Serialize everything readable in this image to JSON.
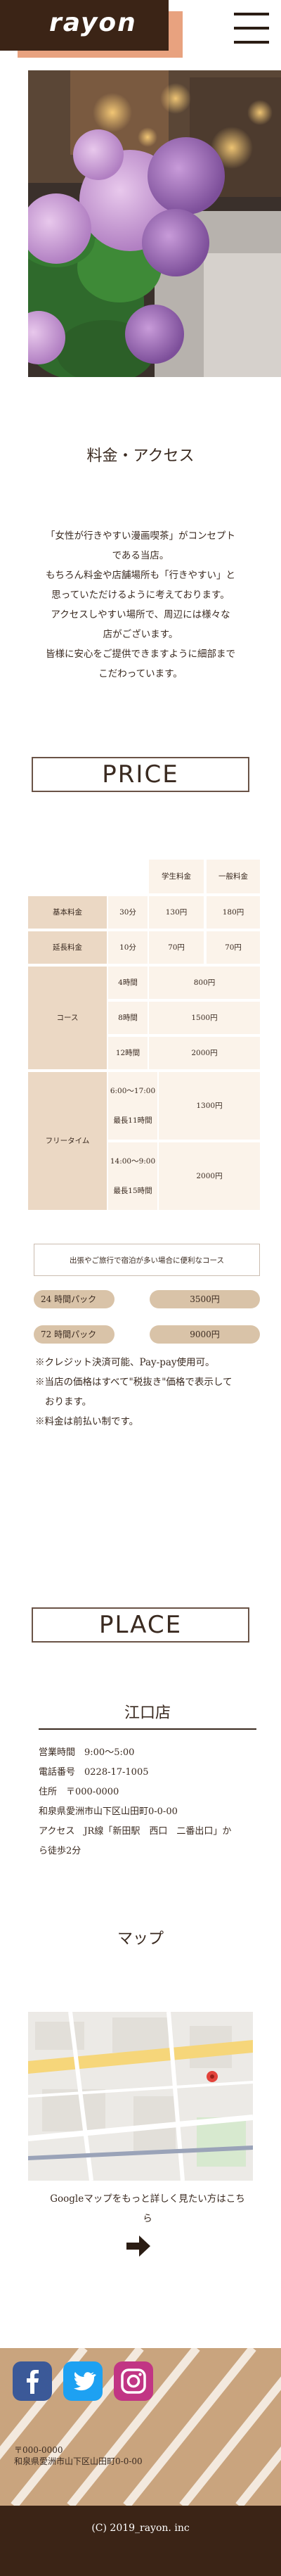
{
  "header": {
    "logo": "rayon",
    "menu_icon": "hamburger-menu-icon"
  },
  "hero": {
    "image": "hydrangea-flowers-photo"
  },
  "about": {
    "title": "料金・アクセス",
    "lines": [
      "「女性が行きやすい漫画喫茶」がコンセプト",
      "である当店。",
      "もちろん料金や店舗場所も「行きやすい」と",
      "思っていただけるように考えております。",
      "アクセスしやすい場所で、周辺には様々な",
      "店がございます。",
      "皆様に安心をご提供できますように細部まで",
      "こだわっています。"
    ]
  },
  "price": {
    "heading": "PRICE",
    "header_student": "学生料金",
    "header_general": "一般料金",
    "basic_label": "基本料金",
    "basic_unit": "30分",
    "basic_student": "130円",
    "basic_general": "180円",
    "extension_label": "延長料金",
    "extension_unit": "10分",
    "extension_student": "70円",
    "extension_general": "70円",
    "course_label": "コース",
    "course_4h": "4時間",
    "course_4h_price": "800円",
    "course_8h": "8時間",
    "course_8h_price": "1500円",
    "course_12h": "12時間",
    "course_12h_price": "2000円",
    "freetime_label": "フリータイム",
    "free_day_time": "6:00～17:00",
    "free_day_max": "最長11時間",
    "free_day_price": "1300円",
    "free_night_time": "14:00～9:00",
    "free_night_max": "最長15時間",
    "free_night_price": "2000円",
    "pack_note": "出張やご旅行で宿泊が多い場合に便利なコース",
    "pack24_label": "24 時間パック",
    "pack24_price": "3500円",
    "pack72_label": "72 時間パック",
    "pack72_price": "9000円",
    "notes": [
      "※クレジット決済可能、Pay-pay使用可。",
      "※当店の価格はすべて\"税抜き\"価格で表示して",
      "おります。",
      "※料金は前払い制です。"
    ]
  },
  "place": {
    "heading": "PLACE",
    "shop_name": "江口店",
    "hours": "営業時間　9:00～5:00",
    "phone": "電話番号　0228-17-1005",
    "address_line1": "住所　〒000-0000",
    "address_line2": "和泉県愛洲市山下区山田町0-0-00",
    "access_line1": "アクセス　JR線「新田駅　西口　二番出口」か",
    "access_line2": "ら徒歩2分"
  },
  "map": {
    "title": "マップ",
    "link_line1": "Googleマップをもっと詳しく見たい方はこち",
    "link_line2": "ら",
    "arrow_icon": "arrow-right-icon"
  },
  "footer": {
    "sns_icons": [
      "facebook-icon",
      "twitter-icon",
      "instagram-icon"
    ],
    "postal": "〒000-0000",
    "address": "和泉県愛洲市山下区山田町0-0-00",
    "copyright": "(C) 2019_rayon. inc"
  }
}
